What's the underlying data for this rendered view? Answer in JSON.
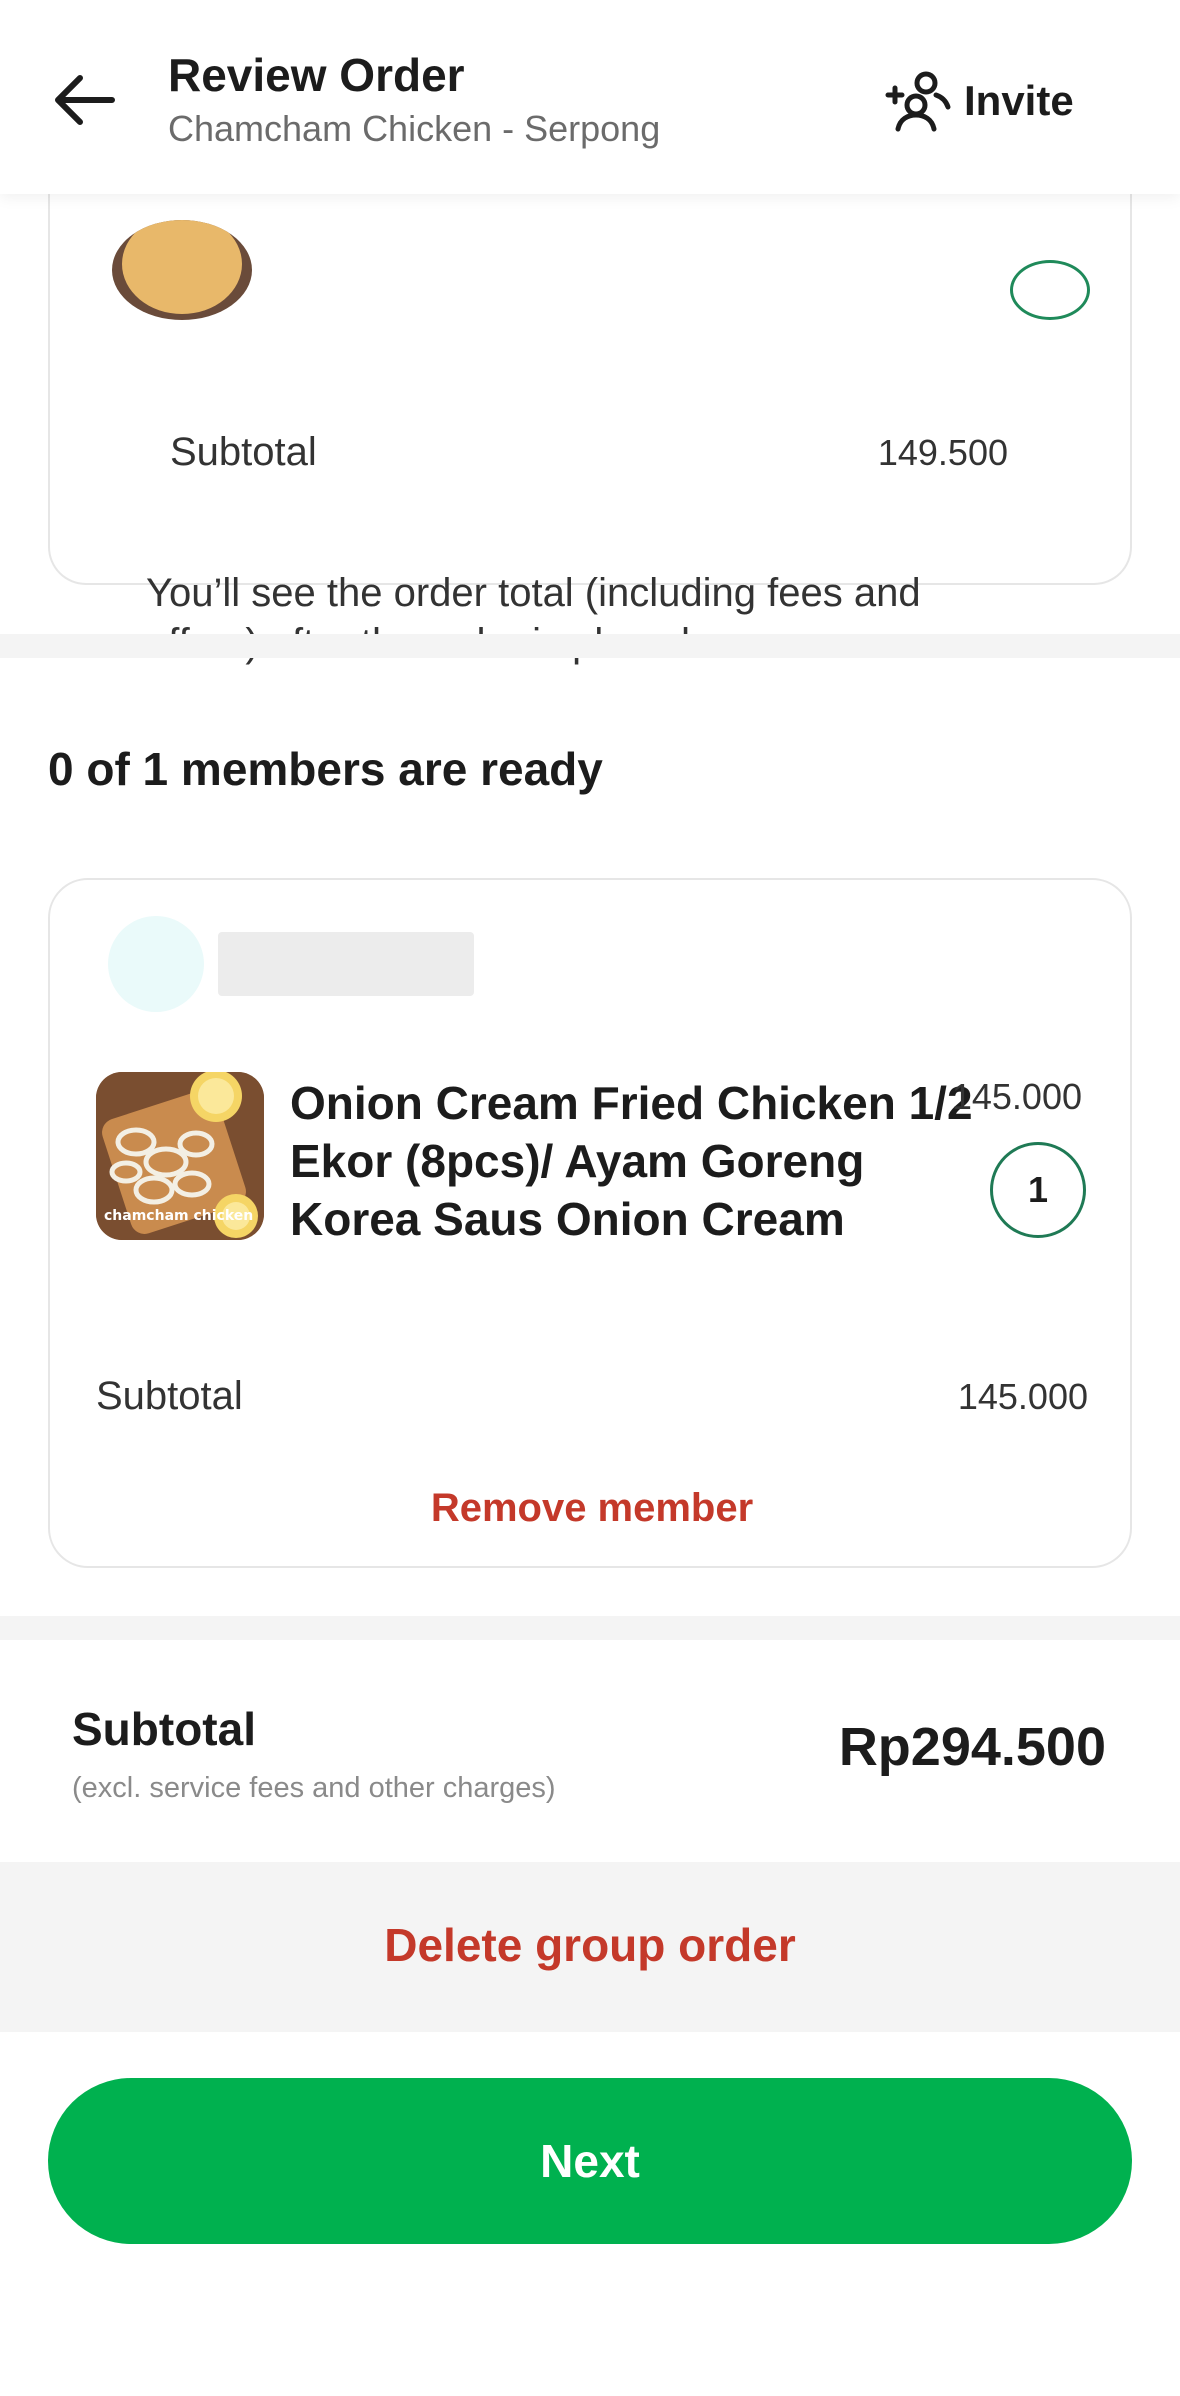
{
  "header": {
    "title": "Review Order",
    "subtitle": "Chamcham Chicken - Serpong",
    "invite_label": "Invite"
  },
  "top_card": {
    "subtotal_label": "Subtotal",
    "subtotal_value": "149.500",
    "note": "You’ll see the order total (including fees and offers) after the order is placed."
  },
  "members": {
    "heading": "0 of 1 members are ready",
    "card": {
      "item": {
        "title": "Onion Cream Fried Chicken 1/2 Ekor (8pcs)/ Ayam Goreng Korea Saus Onion Cream",
        "price": "145.000",
        "quantity": "1",
        "image_caption": "chamcham chicken"
      },
      "subtotal_label": "Subtotal",
      "subtotal_value": "145.000",
      "remove_label": "Remove member"
    }
  },
  "summary": {
    "label": "Subtotal",
    "note": "(excl. service fees and other charges)",
    "value": "Rp294.500"
  },
  "actions": {
    "delete_label": "Delete group order",
    "next_label": "Next"
  },
  "colors": {
    "primary_green": "#00b14f",
    "danger_red": "#c4392a",
    "qty_border": "#1f7a55"
  }
}
